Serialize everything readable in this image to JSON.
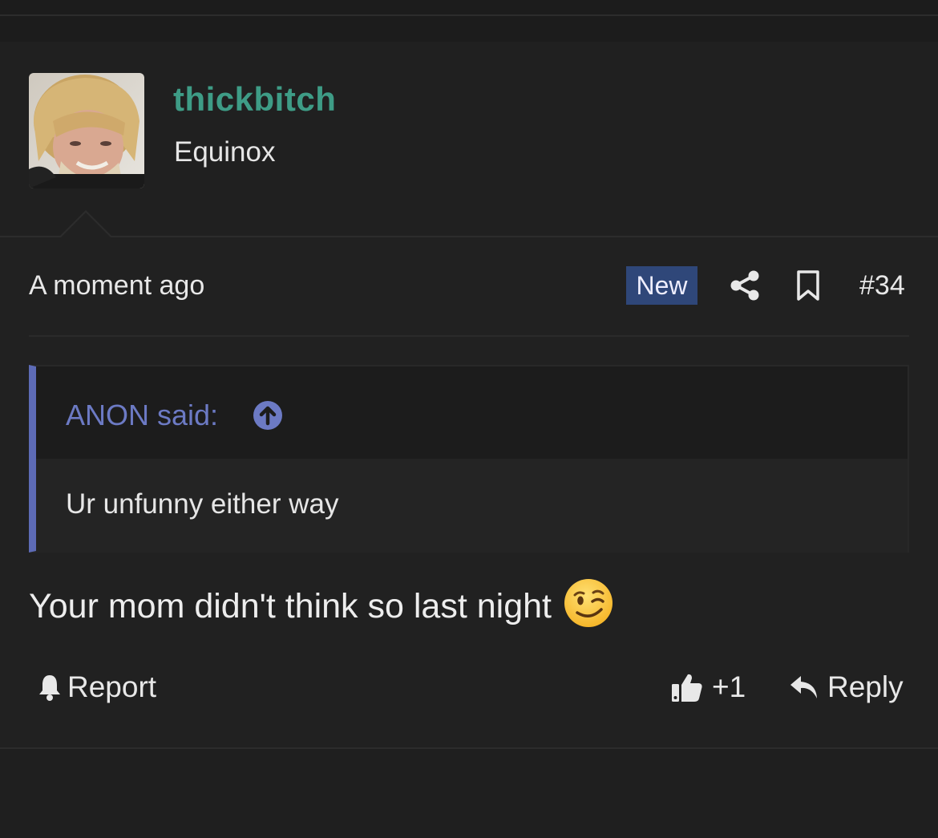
{
  "user": {
    "name": "thickbitch",
    "title": "Equinox"
  },
  "meta": {
    "time": "A moment ago",
    "badge": "New",
    "post_number": "#34"
  },
  "quote": {
    "author_label": "ANON said:",
    "text": "Ur unfunny either way"
  },
  "message": {
    "text": "Your mom didn't think so last night",
    "emoji": "wink-emoji"
  },
  "actions": {
    "report": "Report",
    "like_count": "+1",
    "reply": "Reply"
  },
  "colors": {
    "username": "#3e9c86",
    "quote_accent": "#5d6bb6",
    "badge_bg": "#2f4779"
  }
}
